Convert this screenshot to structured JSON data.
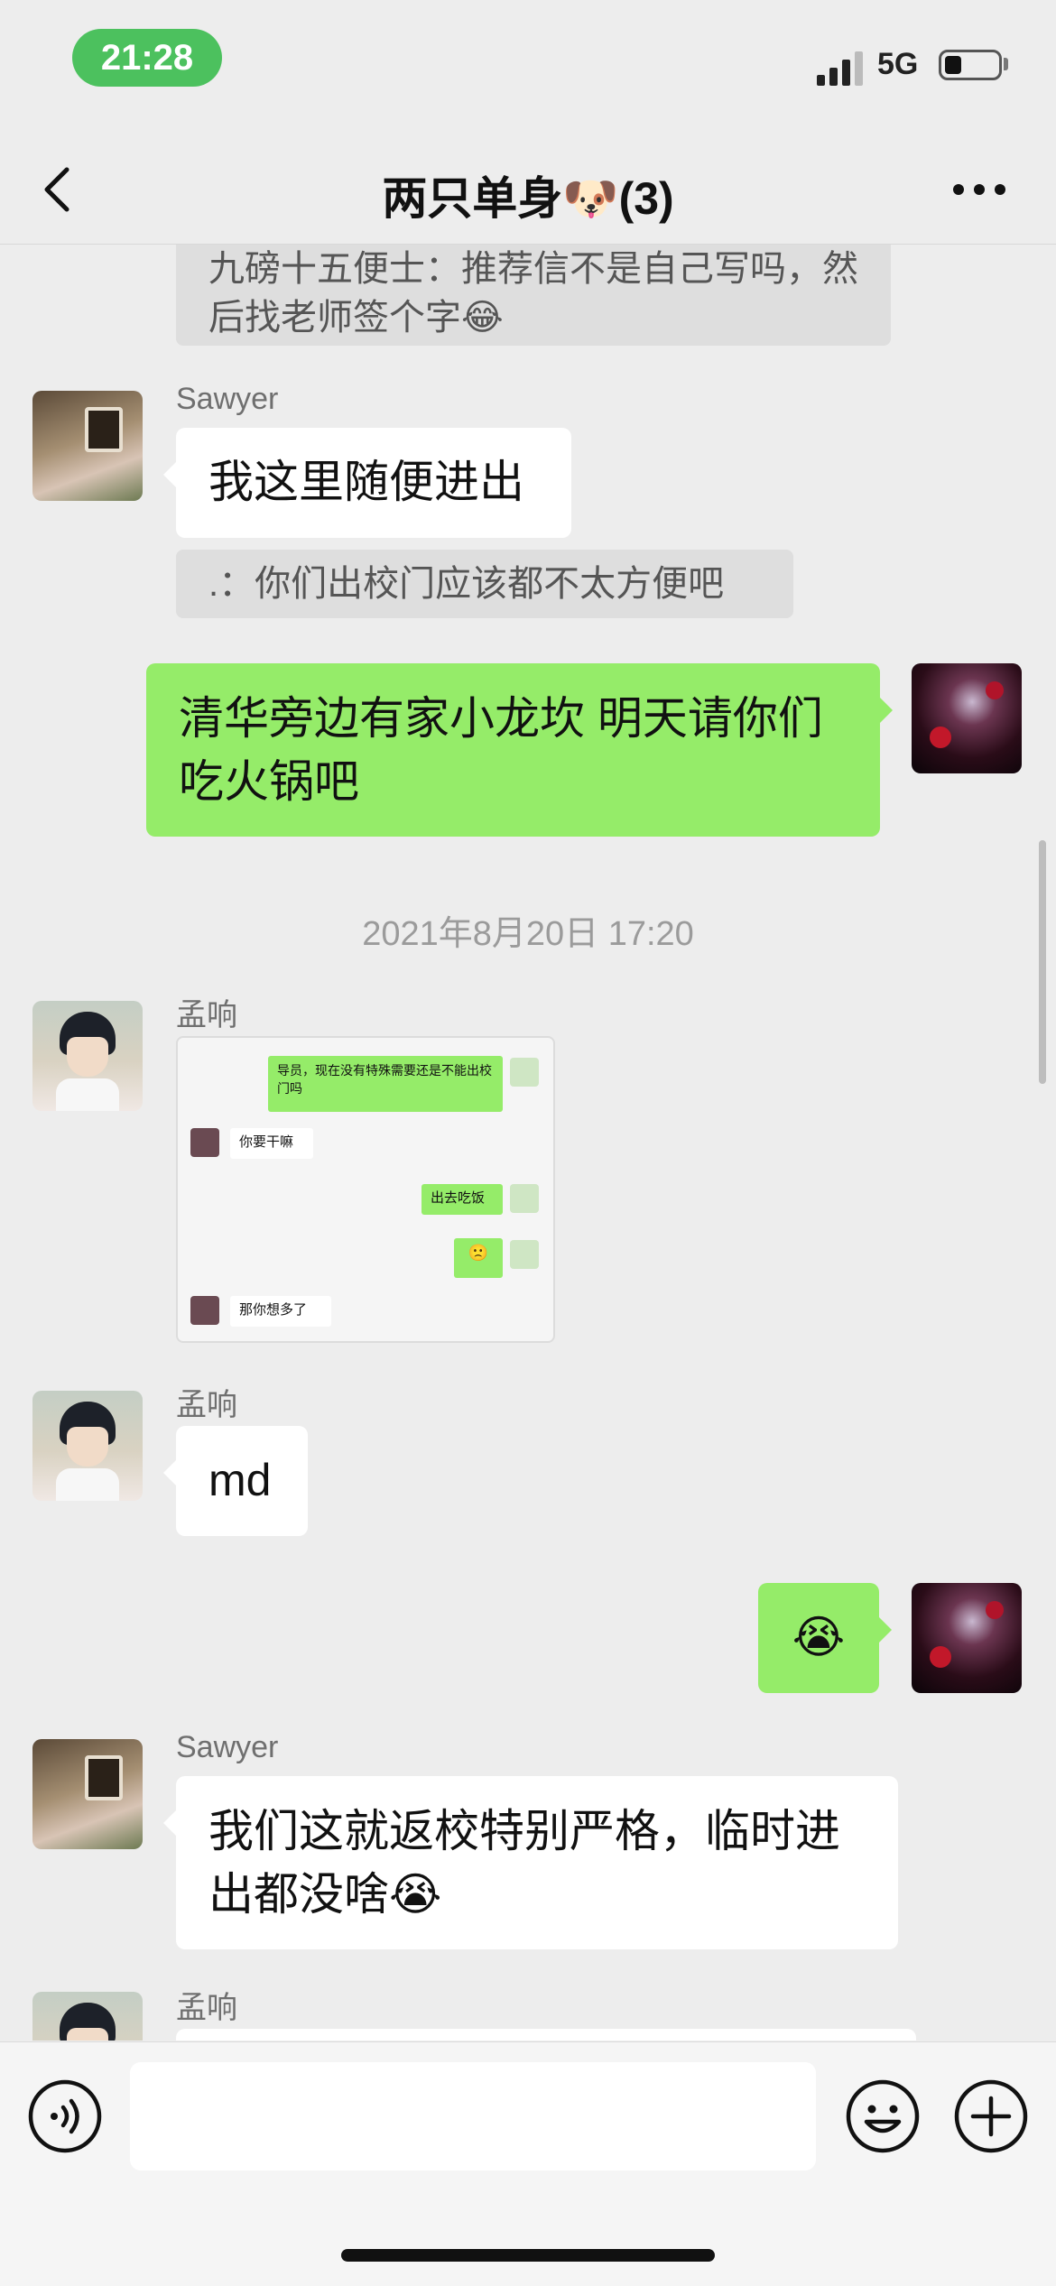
{
  "status_bar": {
    "time": "21:28",
    "network": "5G",
    "battery_level": 0.25
  },
  "header": {
    "title": "两只单身",
    "title_emoji": "🐶",
    "member_count": "(3)"
  },
  "messages": [
    {
      "type": "quote",
      "text": "九磅十五便士：推荐信不是自己写吗，然后找老师签个字",
      "emoji": "😂"
    },
    {
      "type": "text",
      "side": "left",
      "sender": "Sawyer",
      "text": "我这里随便进出"
    },
    {
      "type": "quote",
      "text": ".：你们出校门应该都不太方便吧"
    },
    {
      "type": "text",
      "side": "right",
      "line1": "清华旁边有家小龙坎 明天请你们",
      "line2": "吃火锅吧"
    },
    {
      "type": "timestamp",
      "text": "2021年8月20日 17:20"
    },
    {
      "type": "image",
      "side": "left",
      "sender": "孟响",
      "inner": [
        {
          "side": "right",
          "text": "导员，现在没有特殊需要还是不能出校门吗"
        },
        {
          "side": "left",
          "text": "你要干嘛"
        },
        {
          "side": "right",
          "text": "出去吃饭"
        },
        {
          "side": "right",
          "text": "🙁"
        },
        {
          "side": "left",
          "text": "那你想多了"
        }
      ]
    },
    {
      "type": "text",
      "side": "left",
      "sender": "孟响",
      "text": "md"
    },
    {
      "type": "text",
      "side": "right",
      "text": "😭"
    },
    {
      "type": "text",
      "side": "left",
      "sender": "Sawyer",
      "line1": "我们这就返校特别严格，临时进",
      "line2": "出都没啥",
      "emoji": "😭"
    },
    {
      "type": "text",
      "side": "left",
      "sender": "孟响",
      "text": ""
    }
  ],
  "input": {
    "value": "",
    "placeholder": ""
  },
  "colors": {
    "my_bubble": "#95ec69",
    "their_bubble": "#ffffff",
    "background": "#ededed",
    "time_pill": "#4cc15e"
  },
  "icons": [
    "signal-icon",
    "battery-icon",
    "back-icon",
    "more-icon",
    "voice-icon",
    "emoji-icon",
    "plus-icon"
  ]
}
